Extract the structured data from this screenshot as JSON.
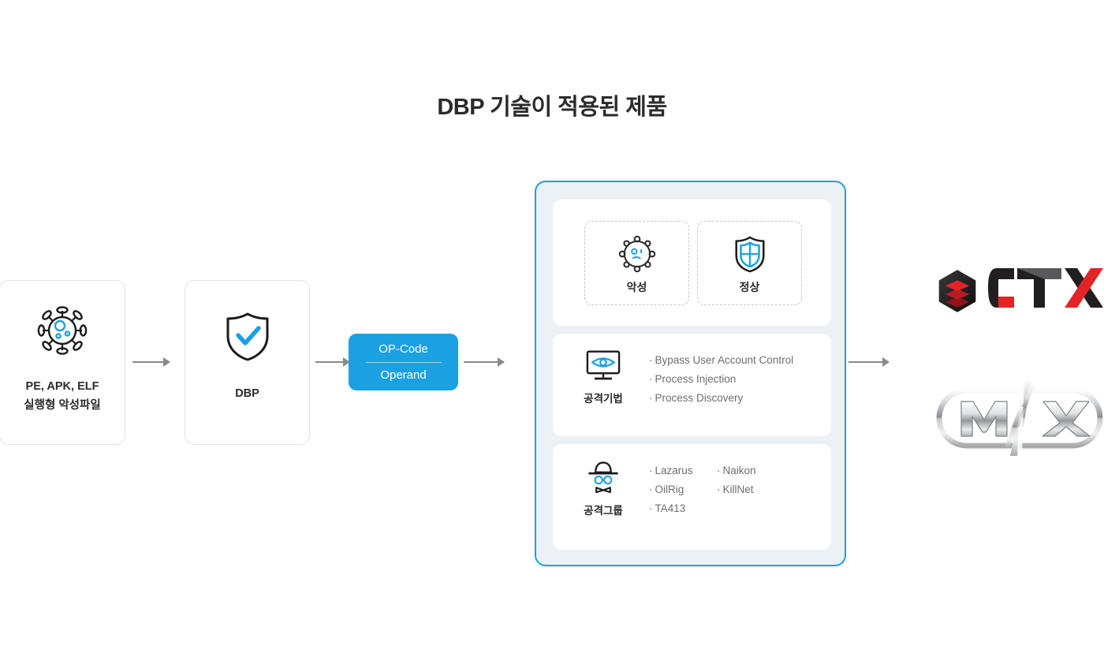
{
  "page": {
    "title": "DBP 기술이 적용된 제품",
    "accent_blue": "#1ba1e2",
    "panel_bg": "#ebf1f4",
    "arrow_color": "#8a8a8a",
    "text_dark": "#2b2b2b",
    "text_gray": "#6e6e6e"
  },
  "flow": {
    "input_card": {
      "icon": "virus-icon",
      "line1": "PE, APK, ELF",
      "line2": "실행형 악성파일"
    },
    "engine_card": {
      "icon": "shield-check-icon",
      "label": "DBP"
    },
    "opcode_box": {
      "line1": "OP-Code",
      "line2": "Operand"
    },
    "arrows": [
      {
        "name": "arrow-input-to-dbp"
      },
      {
        "name": "arrow-dbp-to-opcode"
      },
      {
        "name": "arrow-opcode-to-panel"
      },
      {
        "name": "arrow-panel-to-products"
      }
    ]
  },
  "panel": {
    "detection": {
      "items": [
        {
          "icon": "virus-sad-icon",
          "label": "악성"
        },
        {
          "icon": "shield-cross-icon",
          "label": "정상"
        }
      ]
    },
    "techniques": {
      "icon": "monitor-eye-icon",
      "label": "공격기법",
      "items": [
        "Bypass User Account Control",
        "Process Injection",
        "Process Discovery"
      ]
    },
    "groups": {
      "icon": "spy-hat-icon",
      "label": "공격그룹",
      "column1": [
        "Lazarus",
        "OilRig",
        "TA413"
      ],
      "column2": [
        "Naikon",
        "KillNet"
      ]
    },
    "bullet_char": "·"
  },
  "products": [
    {
      "name": "ctx-logo",
      "wordmark": "CTX",
      "mark": "hexagon-layers-icon",
      "color_dark": "#231f20",
      "color_red": "#e32427"
    },
    {
      "name": "max-logo",
      "wordmark_left": "M",
      "wordmark_right": "X",
      "mark": "chrome-capsule-slash-icon",
      "color_silver": "#b9bcbe"
    }
  ]
}
